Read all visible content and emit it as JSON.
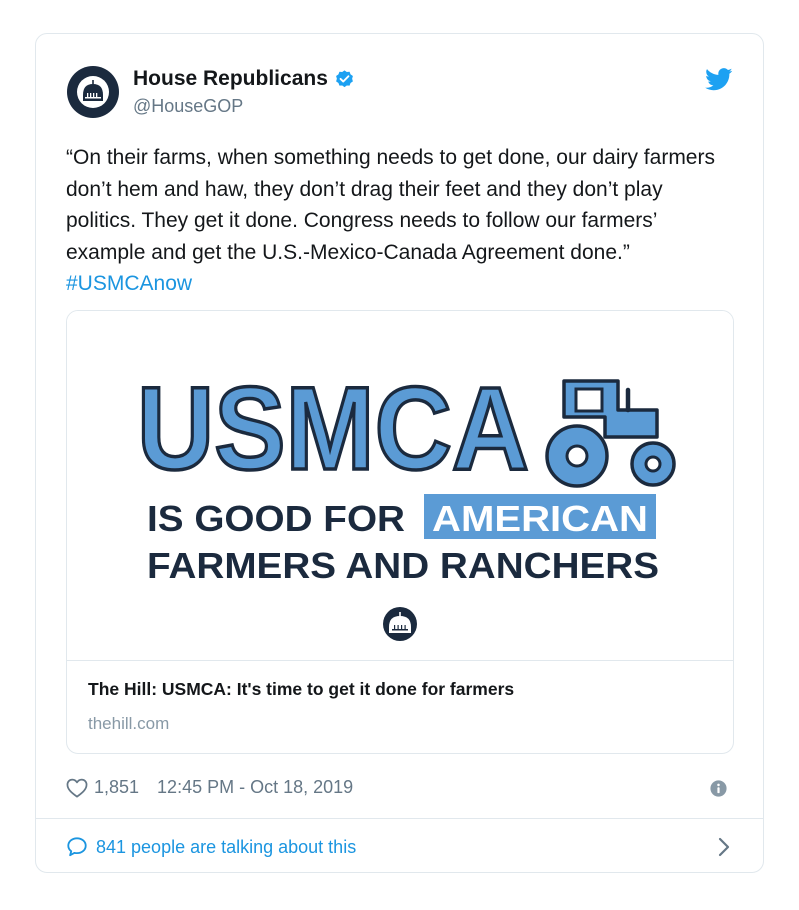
{
  "tweet": {
    "author_name": "House Republicans",
    "handle": "@HouseGOP",
    "text": "“On their farms, when something needs to get done, our dairy farmers don’t hem and haw, they don’t drag their feet and they don’t play politics. They get it done. Congress needs to follow our farmers’ example and get the U.S.-Mexico-Canada Agreement done.”",
    "hashtag": "#USMCAnow",
    "likes": "1,851",
    "timestamp": "12:45 PM - Oct 18, 2019",
    "talking": "841 people are talking about this"
  },
  "link_card": {
    "image": {
      "headline": "USMCA",
      "line1_prefix": "IS GOOD FOR",
      "line1_highlight": "AMERICAN",
      "line2": "FARMERS AND RANCHERS"
    },
    "title": "The Hill: USMCA: It's time to get it done for farmers",
    "domain": "thehill.com"
  },
  "colors": {
    "accent": "#1b95e0",
    "navy": "#1b2a3e",
    "usmca_blue": "#5b9bd5",
    "verified": "#1da1f2"
  },
  "icons": {
    "avatar": "capitol-dome-icon",
    "verified": "verified-badge-icon",
    "brand": "twitter-bird-icon",
    "like": "heart-outline-icon",
    "info": "info-icon",
    "reply": "speech-bubble-icon",
    "more": "chevron-right-icon"
  }
}
